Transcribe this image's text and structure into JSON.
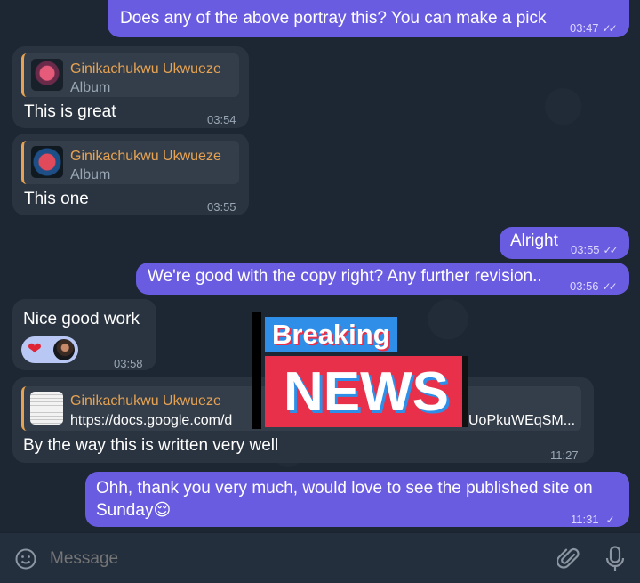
{
  "messages": [
    {
      "text": "Does any of the above portray this? You can make a pick",
      "time": "03:47"
    },
    {
      "reply_name": "Ginikachukwu Ukwueze",
      "reply_sub": "Album",
      "text": "This is great",
      "time": "03:54"
    },
    {
      "reply_name": "Ginikachukwu Ukwueze",
      "reply_sub": "Album",
      "text": "This one",
      "time": "03:55"
    },
    {
      "text": "Alright",
      "time": "03:55"
    },
    {
      "text": "We're good with the copy right? Any further revision..",
      "time": "03:56"
    },
    {
      "text": "Nice good work",
      "time": "03:58"
    },
    {
      "reply_name": "Ginikachukwu Ukwueze",
      "reply_sub": "https://docs.google.com/d",
      "reply_tail": "UoPkuWEqSM...",
      "text": "By the way this is written very well",
      "time": "11:27"
    },
    {
      "text": "Ohh, thank you very much, would love to see the published site on Sunday😌",
      "time": "11:31"
    }
  ],
  "overlay": {
    "breaking": "Breaking",
    "news": "NEWS"
  },
  "composer": {
    "placeholder": "Message"
  },
  "icons": {
    "emoji": "smiley-icon",
    "attach": "paperclip-icon",
    "mic": "microphone-icon",
    "check": "double-check-icon"
  },
  "colors": {
    "outgoing": "#6a5ce0",
    "incoming": "#2a3440",
    "reply_accent": "#e7a352",
    "news_red": "#e8304a",
    "news_blue": "#2f8fe8"
  }
}
